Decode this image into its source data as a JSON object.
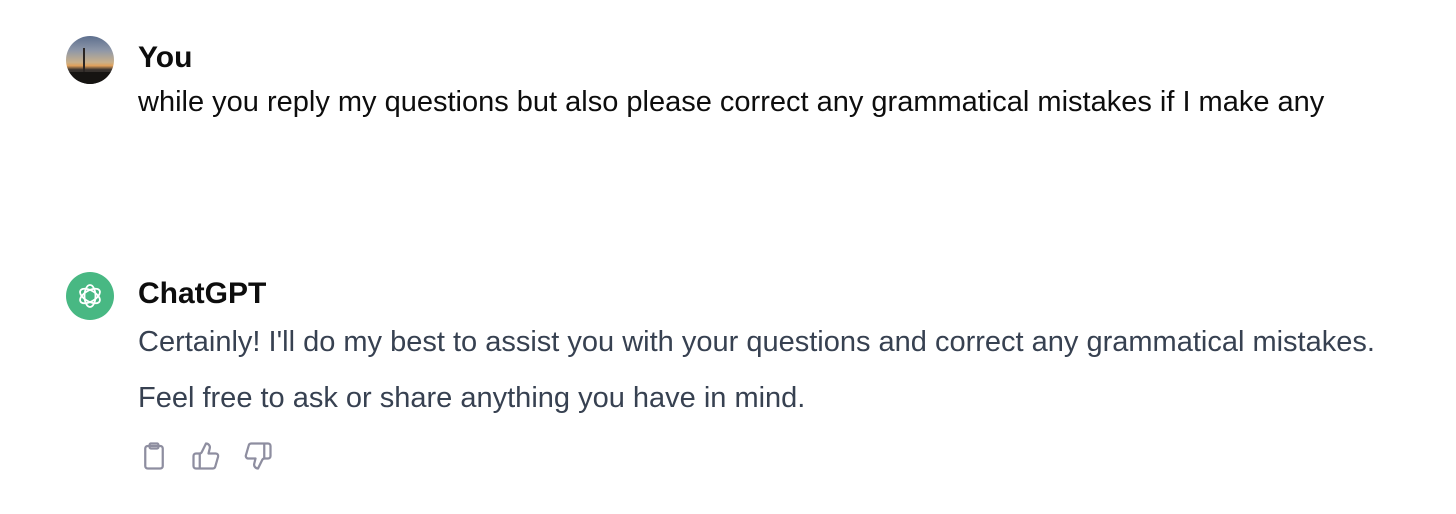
{
  "messages": [
    {
      "role": "user",
      "author": "You",
      "avatar": "user-photo-avatar",
      "text": "while you reply my questions but also please correct any grammatical mistakes if I make any"
    },
    {
      "role": "assistant",
      "author": "ChatGPT",
      "avatar": "chatgpt-logo-icon",
      "text": "Certainly! I'll do my best to assist you with your questions and correct any grammatical mistakes. Feel free to ask or share anything you have in mind.",
      "actions": [
        {
          "icon": "clipboard-icon"
        },
        {
          "icon": "thumbs-up-icon"
        },
        {
          "icon": "thumbs-down-icon"
        }
      ]
    }
  ],
  "colors": {
    "assistant_avatar_bg": "#48b883",
    "user_text": "#0d0d0d",
    "assistant_text": "#374151",
    "icon_stroke": "#8e8ea0"
  }
}
